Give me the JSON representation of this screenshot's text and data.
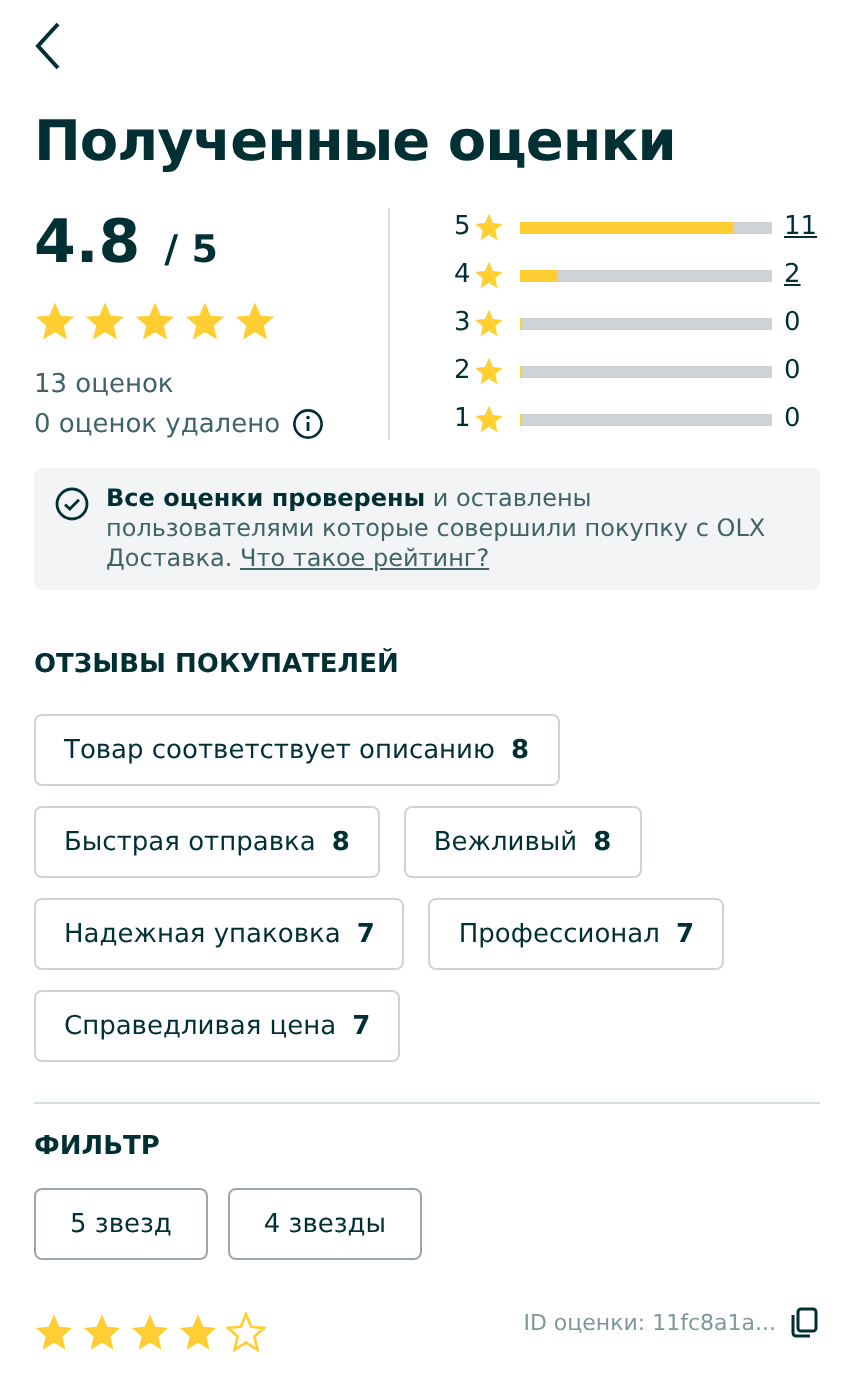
{
  "title": "Полученные оценки",
  "summary": {
    "score": "4.8",
    "out_of": "/ 5",
    "stars": 5,
    "count": "13 оценок",
    "removed": "0 оценок удалено"
  },
  "distribution": [
    {
      "label": "5",
      "level": 0.85,
      "count": "11",
      "link": true
    },
    {
      "label": "4",
      "level": 0.15,
      "count": "2",
      "link": true
    },
    {
      "label": "3",
      "level": 0,
      "count": "0",
      "link": false
    },
    {
      "label": "2",
      "level": 0,
      "count": "0",
      "link": false
    },
    {
      "label": "1",
      "level": 0,
      "count": "0",
      "link": false
    }
  ],
  "notice": {
    "text": "**Все оценки проверены** и оставлены пользователями которые совершили покупку с OLX Доставка.",
    "link": "Что такое рейтинг?"
  },
  "feedback": {
    "heading": "ОТЗЫВЫ ПОКУПАТЕЛЕЙ",
    "tags": [
      {
        "label": "Товар соответствует описанию",
        "count": "8"
      },
      {
        "label": "Быстрая отправка",
        "count": "8"
      },
      {
        "label": "Вежливый",
        "count": "8"
      },
      {
        "label": "Надежная упаковка",
        "count": "7"
      },
      {
        "label": "Профессионал",
        "count": "7"
      },
      {
        "label": "Справедливая цена",
        "count": "7"
      }
    ]
  },
  "filter": {
    "heading": "ФИЛЬТР",
    "options": [
      {
        "label": "5 звезд",
        "selected": false
      },
      {
        "label": "4 звезды",
        "selected": false
      }
    ]
  },
  "review": {
    "stars": 4,
    "id": "ID оценки: 11fc8a1a..."
  }
}
